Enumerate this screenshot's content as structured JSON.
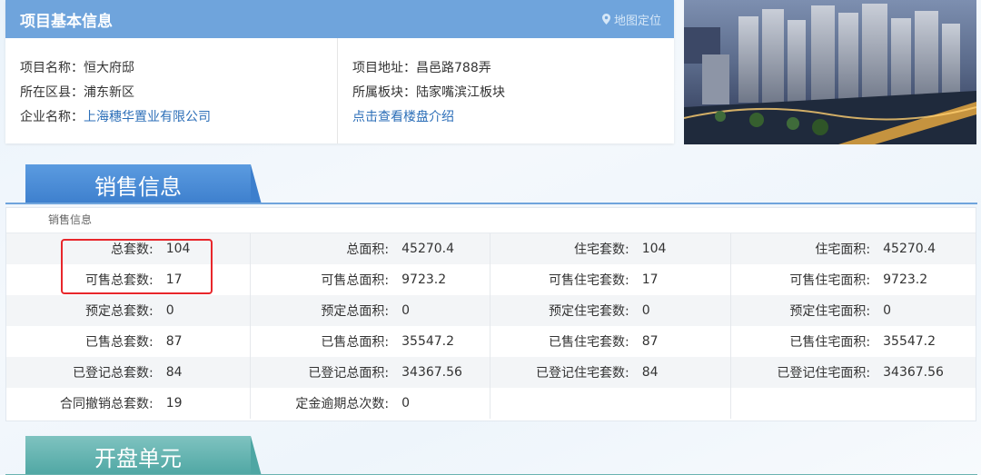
{
  "project": {
    "title": "项目基本信息",
    "map_link": "地图定位",
    "left": [
      {
        "label": "项目名称：",
        "value": "恒大府邸"
      },
      {
        "label": "所在区县：",
        "value": "浦东新区"
      },
      {
        "label": "企业名称：",
        "value": "上海穗华置业有限公司"
      }
    ],
    "right": [
      {
        "label": "项目地址：",
        "value": "昌邑路788弄"
      },
      {
        "label": "所属板块：",
        "value": "陆家嘴滨江板块"
      }
    ],
    "intro_link": "点击查看楼盘介绍"
  },
  "sales": {
    "tab_label": "销售信息",
    "caption": "销售信息",
    "rows": [
      [
        {
          "l": "总套数:",
          "v": "104"
        },
        {
          "l": "总面积:",
          "v": "45270.4"
        },
        {
          "l": "住宅套数:",
          "v": "104"
        },
        {
          "l": "住宅面积:",
          "v": "45270.4"
        }
      ],
      [
        {
          "l": "可售总套数:",
          "v": "17"
        },
        {
          "l": "可售总面积:",
          "v": "9723.2"
        },
        {
          "l": "可售住宅套数:",
          "v": "17"
        },
        {
          "l": "可售住宅面积:",
          "v": "9723.2"
        }
      ],
      [
        {
          "l": "预定总套数:",
          "v": "0"
        },
        {
          "l": "预定总面积:",
          "v": "0"
        },
        {
          "l": "预定住宅套数:",
          "v": "0"
        },
        {
          "l": "预定住宅面积:",
          "v": "0"
        }
      ],
      [
        {
          "l": "已售总套数:",
          "v": "87"
        },
        {
          "l": "已售总面积:",
          "v": "35547.2"
        },
        {
          "l": "已售住宅套数:",
          "v": "87"
        },
        {
          "l": "已售住宅面积:",
          "v": "35547.2"
        }
      ],
      [
        {
          "l": "已登记总套数:",
          "v": "84"
        },
        {
          "l": "已登记总面积:",
          "v": "34367.56"
        },
        {
          "l": "已登记住宅套数:",
          "v": "84"
        },
        {
          "l": "已登记住宅面积:",
          "v": "34367.56"
        }
      ],
      [
        {
          "l": "合同撤销总套数:",
          "v": "19"
        },
        {
          "l": "定金逾期总次数:",
          "v": "0"
        },
        {
          "l": "",
          "v": ""
        },
        {
          "l": "",
          "v": ""
        }
      ]
    ]
  },
  "units": {
    "tab_label": "开盘单元"
  },
  "colors": {
    "header_blue": "#6fa4dc",
    "tab_blue": "#3d7fcd",
    "tab_teal": "#4ea6a3",
    "highlight_red": "#e8262b",
    "link_blue": "#2d6fb8"
  }
}
